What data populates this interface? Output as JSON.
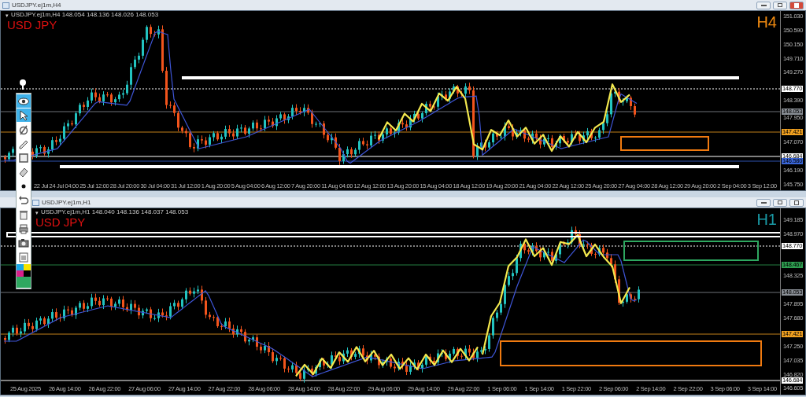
{
  "windows": [
    {
      "title": "USDJPY.ej1m,H4",
      "info_glyph": "▾",
      "info": "USDJPY.ej1m,H4  148.054 148.136 148.026 148.053",
      "symbol": "USD JPY",
      "timeframe": "H4",
      "price_ticks": [
        "151.030",
        "150.590",
        "150.150",
        "149.710",
        "149.270",
        "148.390",
        "147.950",
        "147.070",
        "146.190",
        "145.750"
      ],
      "price_markers": [
        {
          "label": "148.770",
          "color": "#ffffff",
          "kind": "dashed"
        },
        {
          "label": "148.053",
          "color": "#8a8f96",
          "kind": "solid"
        },
        {
          "label": "147.421",
          "color": "#f0a020",
          "kind": "solid"
        },
        {
          "label": "146.684",
          "color": "#ffffff",
          "kind": "solid"
        },
        {
          "label": "146.580",
          "color": "#3a66d8",
          "kind": "solid"
        }
      ],
      "time_labels": [
        "22 Jul",
        "24 Jul 04:00",
        "25 Jul 12:00",
        "28 Jul 20:00",
        "30 Jul 04:00",
        "31 Jul 12:00",
        "1 Aug 20:00",
        "5 Aug 04:00",
        "6 Aug 12:00",
        "7 Aug 20:00",
        "11 Aug 04:00",
        "12 Aug 12:00",
        "13 Aug 20:00",
        "15 Aug 04:00",
        "18 Aug 12:00",
        "19 Aug 20:00",
        "21 Aug 04:00",
        "22 Aug 12:00",
        "25 Aug 20:00",
        "27 Aug 04:00",
        "28 Aug 12:00",
        "29 Aug 20:00",
        "2 Sep 04:00",
        "3 Sep 12:00"
      ]
    },
    {
      "title": "USDJPY.ej1m,H1",
      "info_glyph": "▾",
      "info": "USDJPY.ej1m,H1  148.040 148.136 148.037 148.053",
      "symbol": "USD JPY",
      "timeframe": "H1",
      "price_ticks": [
        "149.185",
        "148.970",
        "148.325",
        "147.895",
        "147.680",
        "147.250",
        "147.035",
        "146.820",
        "146.605"
      ],
      "price_markers": [
        {
          "label": "148.770",
          "color": "#ffffff",
          "kind": "dashed"
        },
        {
          "label": "148.467",
          "color": "#2e9e50",
          "kind": "solid"
        },
        {
          "label": "148.053",
          "color": "#8a8f96",
          "kind": "solid"
        },
        {
          "label": "147.421",
          "color": "#f0a020",
          "kind": "solid"
        },
        {
          "label": "146.684",
          "color": "#ffffff",
          "kind": "solid"
        }
      ],
      "time_labels": [
        "25 Aug 2025",
        "26 Aug 14:00",
        "26 Aug 22:00",
        "27 Aug 06:00",
        "27 Aug 14:00",
        "27 Aug 22:00",
        "28 Aug 06:00",
        "28 Aug 14:00",
        "28 Aug 22:00",
        "29 Aug 06:00",
        "29 Aug 14:00",
        "29 Aug 22:00",
        "1 Sep 06:00",
        "1 Sep 14:00",
        "1 Sep 22:00",
        "2 Sep 06:00",
        "2 Sep 14:00",
        "2 Sep 22:00",
        "3 Sep 06:00",
        "3 Sep 14:00"
      ]
    }
  ],
  "toolbar": {
    "tools": [
      {
        "selected": true
      },
      {
        "selected": true
      },
      {
        "selected": false
      },
      {
        "selected": false
      },
      {
        "selected": false
      },
      {
        "selected": false
      },
      {
        "selected": false
      },
      {
        "selected": false
      },
      {
        "selected": false
      },
      {
        "selected": false
      },
      {
        "selected": false
      },
      {
        "selected": false
      }
    ]
  }
}
